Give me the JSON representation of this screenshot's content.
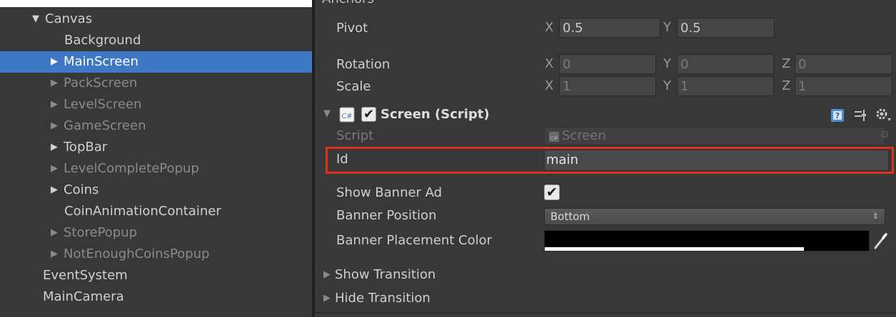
{
  "hierarchy": {
    "items": [
      {
        "label": "Canvas",
        "arrow": "▼",
        "selected": false,
        "dim": false
      },
      {
        "label": "Background",
        "arrow": "",
        "selected": false,
        "dim": false
      },
      {
        "label": "MainScreen",
        "arrow": "▶",
        "selected": true,
        "dim": false
      },
      {
        "label": "PackScreen",
        "arrow": "▶",
        "selected": false,
        "dim": true
      },
      {
        "label": "LevelScreen",
        "arrow": "▶",
        "selected": false,
        "dim": true
      },
      {
        "label": "GameScreen",
        "arrow": "▶",
        "selected": false,
        "dim": true
      },
      {
        "label": "TopBar",
        "arrow": "▶",
        "selected": false,
        "dim": false
      },
      {
        "label": "LevelCompletePopup",
        "arrow": "▶",
        "selected": false,
        "dim": true
      },
      {
        "label": "Coins",
        "arrow": "▶",
        "selected": false,
        "dim": false
      },
      {
        "label": "CoinAnimationContainer",
        "arrow": "",
        "selected": false,
        "dim": false
      },
      {
        "label": "StorePopup",
        "arrow": "▶",
        "selected": false,
        "dim": true
      },
      {
        "label": "NotEnoughCoinsPopup",
        "arrow": "▶",
        "selected": false,
        "dim": true
      },
      {
        "label": "EventSystem",
        "arrow": "",
        "selected": false,
        "dim": false
      },
      {
        "label": "MainCamera",
        "arrow": "",
        "selected": false,
        "dim": false
      }
    ],
    "colors": {
      "selected_bg": "#3e78c4",
      "panel_bg": "#383838"
    }
  },
  "inspector": {
    "anchors_label": "Anchors",
    "pivot": {
      "label": "Pivot",
      "x_axis": "X",
      "x": "0.5",
      "y_axis": "Y",
      "y": "0.5"
    },
    "rotation": {
      "label": "Rotation",
      "x_axis": "X",
      "x": "0",
      "y_axis": "Y",
      "y": "0",
      "z_axis": "Z",
      "z": "0"
    },
    "scale": {
      "label": "Scale",
      "x_axis": "X",
      "x": "1",
      "y_axis": "Y",
      "y": "1",
      "z_axis": "Z",
      "z": "1"
    },
    "component": {
      "title": "Screen (Script)",
      "enabled": true,
      "script_label": "Script",
      "script_value": "Screen",
      "id_label": "Id",
      "id_value": "main",
      "show_banner_label": "Show Banner Ad",
      "show_banner_checked": true,
      "banner_position_label": "Banner Position",
      "banner_position_value": "Bottom",
      "banner_color_label": "Banner Placement Color",
      "banner_color": "#000000",
      "banner_color_alpha": 0.8
    },
    "foldouts": {
      "show_transition": "Show Transition",
      "hide_transition": "Hide Transition"
    },
    "highlight_color": "#e0301e"
  }
}
